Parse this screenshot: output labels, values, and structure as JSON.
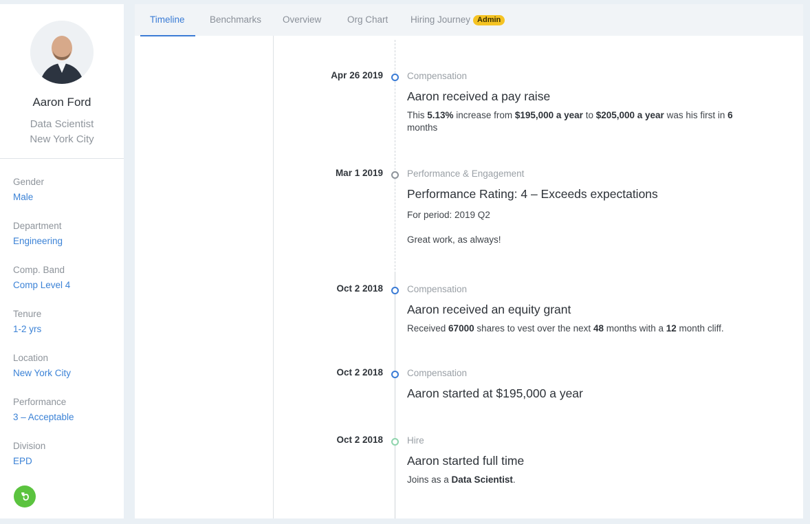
{
  "profile": {
    "name": "Aaron Ford",
    "title": "Data Scientist",
    "location": "New York City",
    "attributes": [
      {
        "label": "Gender",
        "value": "Male"
      },
      {
        "label": "Department",
        "value": "Engineering"
      },
      {
        "label": "Comp. Band",
        "value": "Comp Level 4"
      },
      {
        "label": "Tenure",
        "value": "1-2 yrs"
      },
      {
        "label": "Location",
        "value": "New York City"
      },
      {
        "label": "Performance",
        "value": "3 – Acceptable"
      },
      {
        "label": "Division",
        "value": "EPD"
      }
    ]
  },
  "tabs": [
    {
      "label": "Timeline",
      "active": true
    },
    {
      "label": "Benchmarks"
    },
    {
      "label": "Overview"
    },
    {
      "label": "Org Chart"
    },
    {
      "label": "Hiring Journey",
      "badge": "Admin"
    }
  ],
  "timeline": [
    {
      "date": "Apr 26 2019",
      "category": "Compensation",
      "title": "Aaron received a pay raise",
      "desc": {
        "p1": "This ",
        "b1": "5.13%",
        "p2": " increase from ",
        "b2": "$195,000 a year",
        "p3": " to ",
        "b3": "$205,000 a year",
        "p4": " was his first in ",
        "b4": "6",
        "p5": " months"
      }
    },
    {
      "date": "Mar 1 2019",
      "category": "Performance & Engagement",
      "title": "Performance Rating: 4 – Exceeds expectations",
      "period": "For period: 2019 Q2",
      "note": "Great work, as always!"
    },
    {
      "date": "Oct 2 2018",
      "category": "Compensation",
      "title": "Aaron received an equity grant",
      "desc": {
        "p1": "Received ",
        "b1": "67000",
        "p2": " shares to vest over the next ",
        "b2": "48",
        "p3": " months with a ",
        "b3": "12",
        "p4": " month cliff."
      }
    },
    {
      "date": "Oct 2 2018",
      "category": "Compensation",
      "title": "Aaron started at $195,000 a year"
    },
    {
      "date": "Oct 2 2018",
      "category": "Hire",
      "title": "Aaron started full time",
      "desc": {
        "p1": "Joins as a ",
        "b1": "Data Scientist",
        "p2": "."
      }
    }
  ],
  "colors": {
    "accent": "#3a7bd5",
    "badge": "#f5c323",
    "help": "#5bc33f"
  },
  "icons": {
    "help": "help-icon"
  }
}
